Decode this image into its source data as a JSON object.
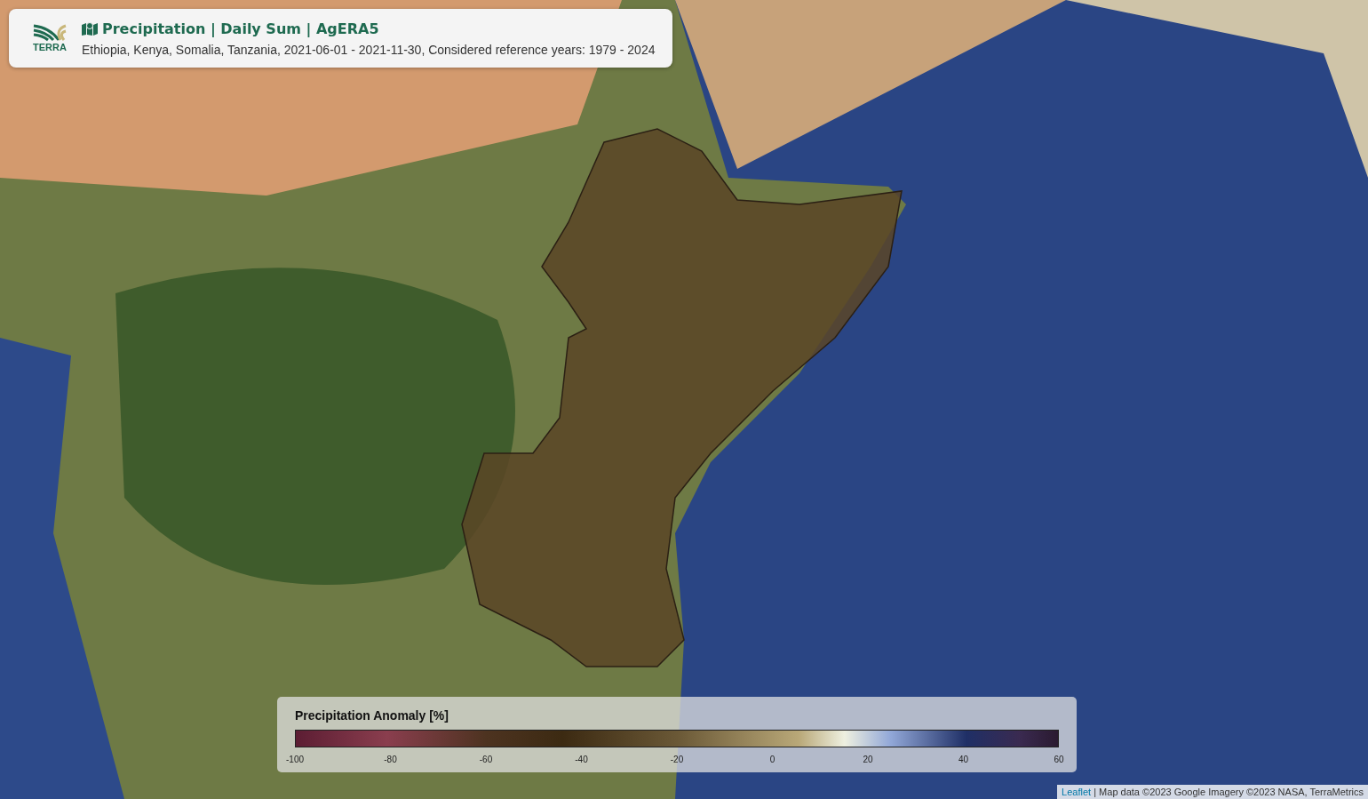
{
  "header": {
    "logo_text": "TERRA",
    "title": "Precipitation | Daily Sum | AgERA5",
    "subtitle": "Ethiopia, Kenya, Somalia, Tanzania, 2021-06-01 - 2021-11-30, Considered reference years: 1979 - 2024"
  },
  "legend": {
    "title": "Precipitation Anomaly [%]",
    "ticks": [
      "-100",
      "-80",
      "-60",
      "-40",
      "-20",
      "0",
      "20",
      "40",
      "60"
    ]
  },
  "attribution": {
    "link": "Leaflet",
    "text": "| Map data ©2023 Google Imagery ©2023 NASA, TerraMetrics"
  }
}
